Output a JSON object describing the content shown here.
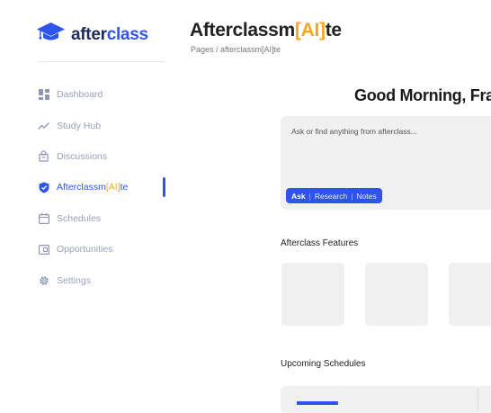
{
  "brand": {
    "name_part1": "after",
    "name_part2": "class",
    "icon": "graduation-cap-icon",
    "accent_color": "#2f54eb",
    "highlight_color": "#f5a623"
  },
  "sidebar": {
    "items": [
      {
        "label": "Dashboard",
        "icon": "dashboard-icon",
        "active": false
      },
      {
        "label": "Study Hub",
        "icon": "trend-line-icon",
        "active": false
      },
      {
        "label": "Discussions",
        "icon": "discussions-icon",
        "active": false
      },
      {
        "label_pre": "Afterclassm",
        "label_ai": "[AI]",
        "label_post": "te",
        "icon": "shield-icon",
        "active": true
      },
      {
        "label": "Schedules",
        "icon": "calendar-icon",
        "active": false
      },
      {
        "label": "Opportunities",
        "icon": "wallet-icon",
        "active": false
      },
      {
        "label": "Settings",
        "icon": "gear-icon",
        "active": false
      }
    ]
  },
  "header": {
    "title_pre": "Afterclassm",
    "title_ai": "[AI]",
    "title_post": "te",
    "breadcrumb": "Pages / afterclassm[AI]te"
  },
  "main": {
    "greeting": "Good Morning, Fra",
    "ask": {
      "placeholder": "Ask or find anything from afterclass...",
      "modes": [
        "Ask",
        "Research",
        "Notes"
      ],
      "selected_mode": "Ask"
    },
    "features_title": "Afterclass Features",
    "schedules_title": "Upcoming Schedules"
  }
}
